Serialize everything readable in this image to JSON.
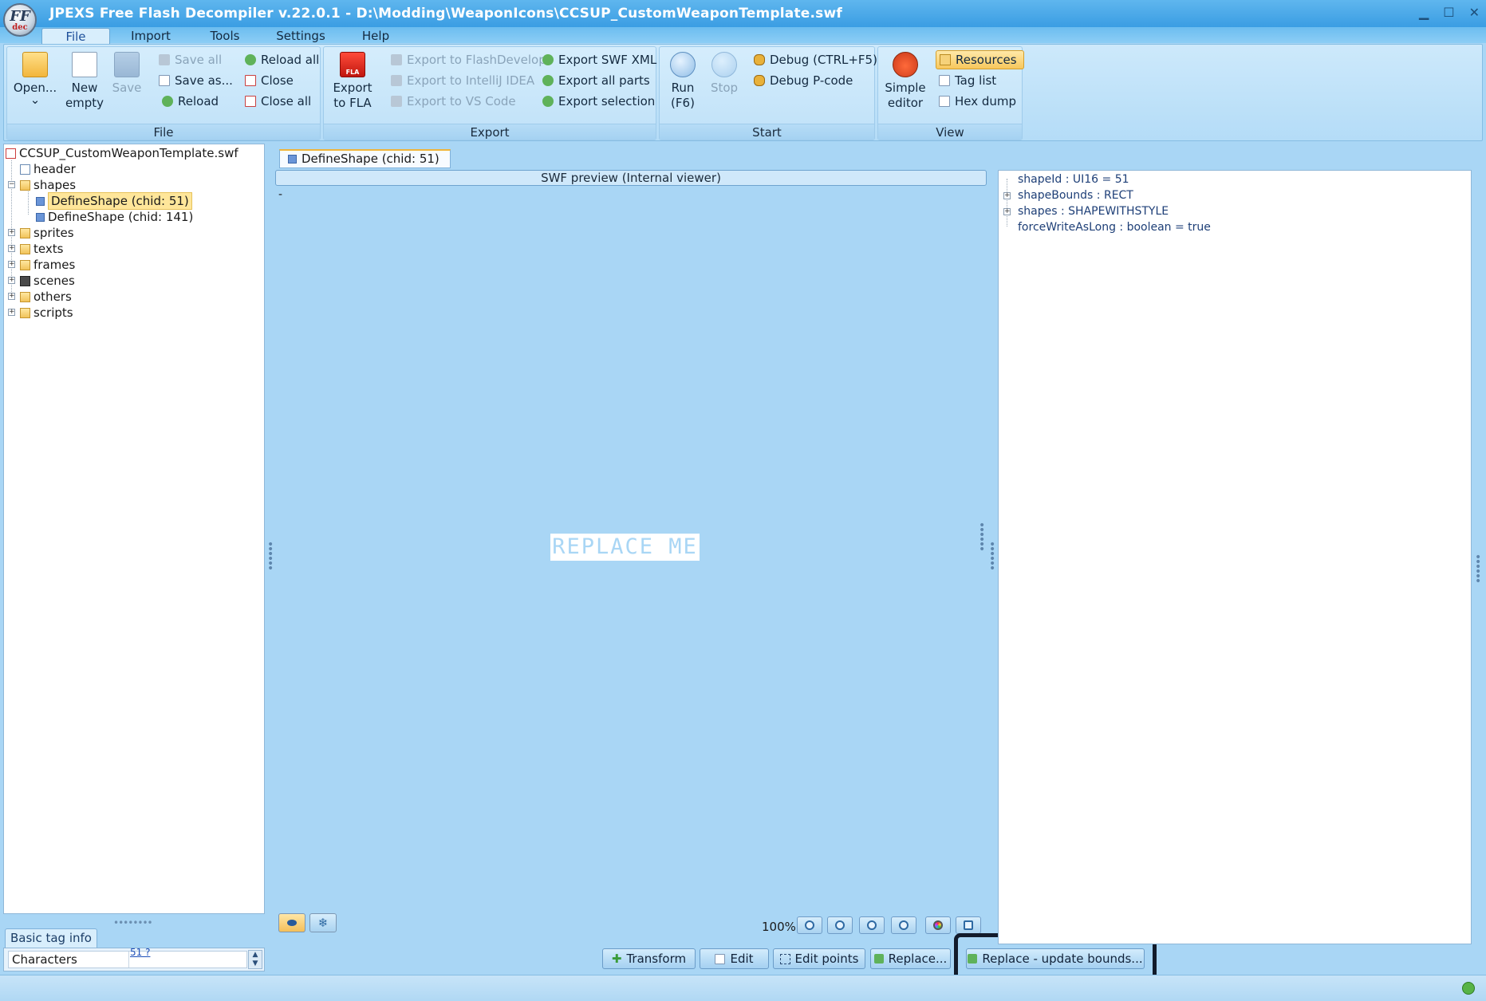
{
  "window": {
    "title": "JPEXS Free Flash Decompiler v.22.0.1 - D:\\Modding\\WeaponIcons\\CCSUP_CustomWeaponTemplate.swf",
    "logo_text": "FF",
    "logo_sub": "dec",
    "minimize": "▁",
    "maximize": "☐",
    "close": "✕"
  },
  "menu": {
    "file": "File",
    "import": "Import",
    "tools": "Tools",
    "settings": "Settings",
    "help": "Help"
  },
  "ribbon": {
    "file_group": {
      "label": "File",
      "open": "Open...",
      "open_arrow": "⌄",
      "new_empty_1": "New",
      "new_empty_2": "empty",
      "save": "Save",
      "save_all": "Save all",
      "save_as": "Save as...",
      "reload": "Reload",
      "reload_all": "Reload all",
      "close": "Close",
      "close_all": "Close all"
    },
    "export_group": {
      "label": "Export",
      "export_fla_1": "Export",
      "export_fla_2": "to FLA",
      "fla_icon_text": "FLA",
      "to_flashdevelop": "Export to FlashDevelop",
      "to_intellij": "Export to IntelliJ IDEA",
      "to_vscode": "Export to VS Code",
      "swf_xml": "Export SWF XML",
      "all_parts": "Export all parts",
      "selection": "Export selection"
    },
    "start_group": {
      "label": "Start",
      "run_1": "Run",
      "run_2": "(F6)",
      "stop": "Stop",
      "debug": "Debug (CTRL+F5)",
      "debug_pcode": "Debug P-code"
    },
    "view_group": {
      "label": "View",
      "simple_editor_1": "Simple",
      "simple_editor_2": "editor",
      "resources": "Resources",
      "tag_list": "Tag list",
      "hex_dump": "Hex dump"
    }
  },
  "tree": {
    "root": "CCSUP_CustomWeaponTemplate.swf",
    "header": "header",
    "shapes": "shapes",
    "shape_51": "DefineShape (chid: 51)",
    "shape_141": "DefineShape (chid: 141)",
    "sprites": "sprites",
    "texts": "texts",
    "frames": "frames",
    "scenes": "scenes",
    "others": "others",
    "scripts": "scripts"
  },
  "basic_info": {
    "tab": "Basic tag info",
    "characters_label": "Characters",
    "characters_value": "51 ?"
  },
  "preview": {
    "doc_tab": "DefineShape (chid: 51)",
    "header": "SWF preview (Internal viewer)",
    "dash": "-",
    "canvas_text": "REPLACE ME",
    "zoom": "100%"
  },
  "actions": {
    "transform": "Transform",
    "edit": "Edit",
    "edit_points": "Edit points",
    "replace": "Replace...",
    "replace_update": "Replace - update bounds..."
  },
  "properties": {
    "shape_id": "shapeId : UI16 = 51",
    "shape_bounds": "shapeBounds : RECT",
    "shapes": "shapes : SHAPEWITHSTYLE",
    "force_write": "forceWriteAsLong : boolean = true"
  },
  "colors": {
    "background": "#a9d6f5",
    "accent": "#f0b53a",
    "highlight_frame": "#121b2b"
  }
}
